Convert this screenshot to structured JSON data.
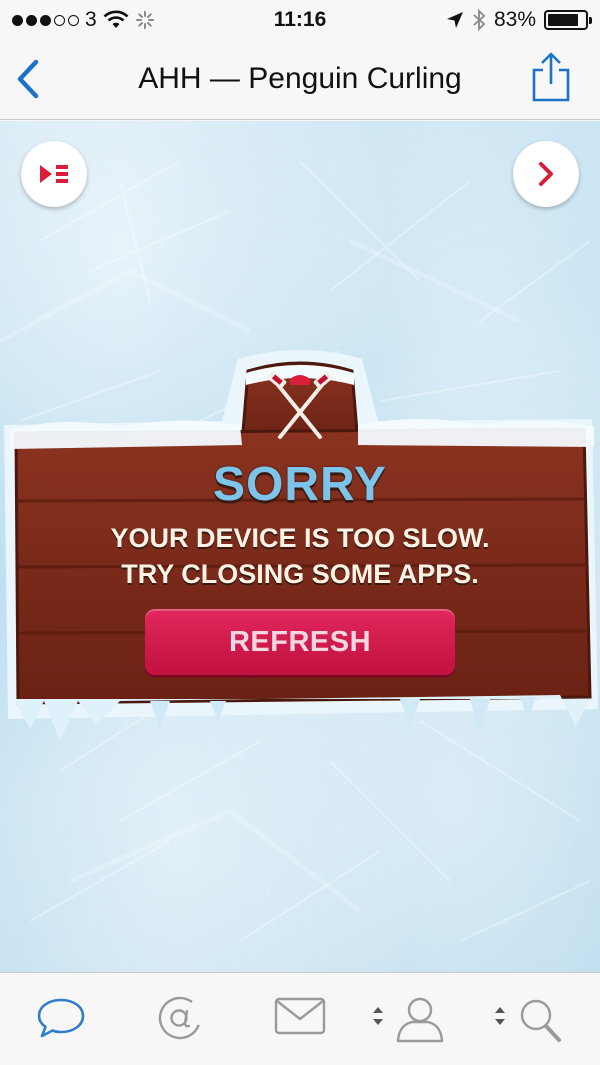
{
  "status": {
    "carrier": "3",
    "time": "11:16",
    "battery": "83%",
    "battery_level": 0.83,
    "signal_bars_filled": 3,
    "signal_bars_total": 5
  },
  "nav": {
    "title": "AHH — Penguin Curling"
  },
  "game": {
    "heading": "SORRY",
    "message_line1": "YOUR DEVICE IS TOO SLOW.",
    "message_line2": "TRY CLOSING SOME APPS.",
    "refresh_label": "REFRESH"
  },
  "colors": {
    "ios_blue": "#1a73c9",
    "heading_blue": "#7cc4ea",
    "button_red": "#d21a4e",
    "wood": "#7a2a1a",
    "tab_icon_active": "#2f7fc8",
    "tab_icon_inactive": "#9a9a9a"
  },
  "tabs": [
    {
      "icon": "speech-bubble-icon",
      "active": true
    },
    {
      "icon": "at-sign-icon",
      "active": false
    },
    {
      "icon": "envelope-icon",
      "active": false
    },
    {
      "icon": "profile-icon",
      "active": false
    },
    {
      "icon": "search-icon",
      "active": false
    }
  ]
}
